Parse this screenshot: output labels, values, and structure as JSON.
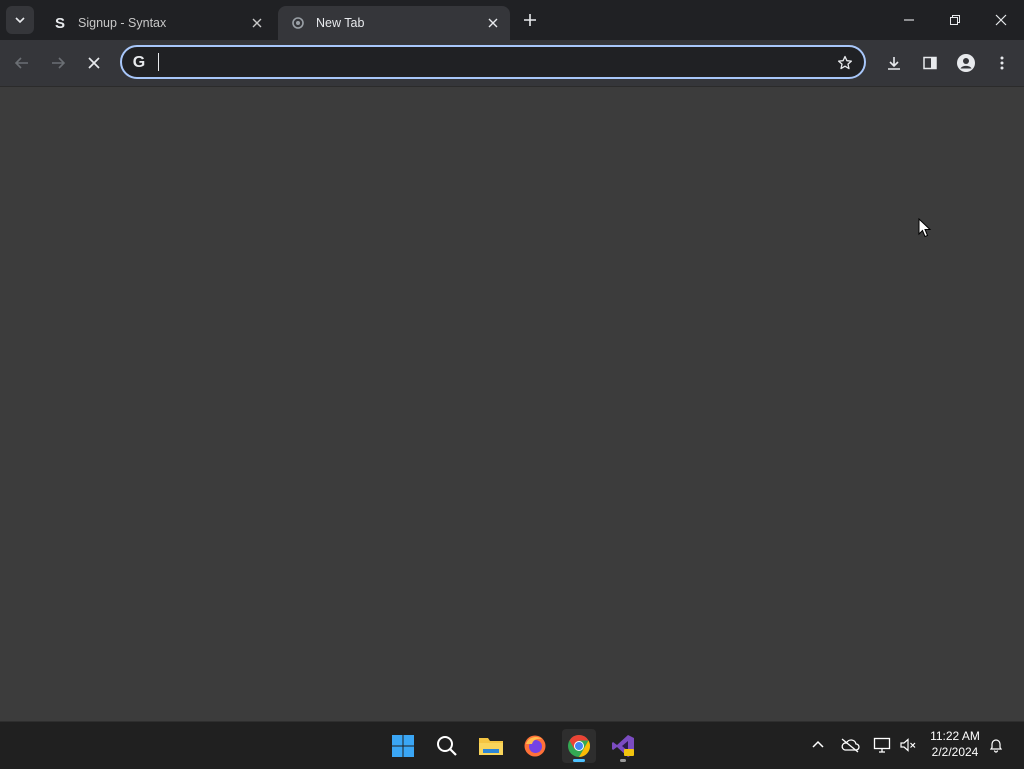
{
  "browser": {
    "tabs": [
      {
        "title": "Signup - Syntax",
        "active": false,
        "favicon": "syntax-s-icon"
      },
      {
        "title": "New Tab",
        "active": true,
        "favicon": "loading-icon"
      }
    ],
    "omnibox": {
      "value": "",
      "placeholder": ""
    },
    "accent_color": "#a8c7fa"
  },
  "taskbar": {
    "apps": [
      "windows-start-icon",
      "search-icon",
      "file-explorer-icon",
      "firefox-icon",
      "chrome-icon",
      "visual-studio-icon"
    ],
    "clock": {
      "time": "11:22 AM",
      "date": "2/2/2024"
    }
  }
}
